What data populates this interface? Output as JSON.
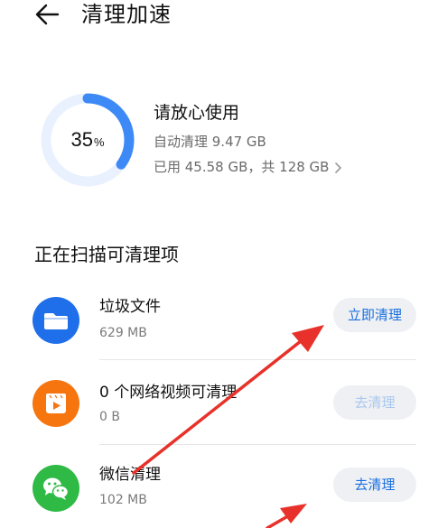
{
  "header": {
    "title": "清理加速"
  },
  "storage": {
    "percent_num": "35",
    "percent_unit": "%",
    "used_fraction": 0.35,
    "status_title": "请放心使用",
    "auto_clean": "自动清理 9.47 GB",
    "usage": "已用 45.58 GB，共 128 GB"
  },
  "section": {
    "title": "正在扫描可清理项"
  },
  "items": [
    {
      "name": "垃圾文件",
      "size": "629 MB",
      "button": "立即清理",
      "icon": "folder-icon",
      "enabled": true
    },
    {
      "name": "0 个网络视频可清理",
      "size": "0 B",
      "button": "去清理",
      "icon": "video-icon",
      "enabled": false
    },
    {
      "name": "微信清理",
      "size": "102 MB",
      "button": "去清理",
      "icon": "wechat-icon",
      "enabled": true
    }
  ],
  "colors": {
    "accent": "#1a6fe0",
    "ring_track": "#e8f1fd",
    "ring_fill": "#3d8af7",
    "folder_bg": "#1f6fea",
    "video_bg": "#f6750e",
    "wechat_bg": "#2fba45",
    "annotation_arrow": "#e8312a"
  }
}
